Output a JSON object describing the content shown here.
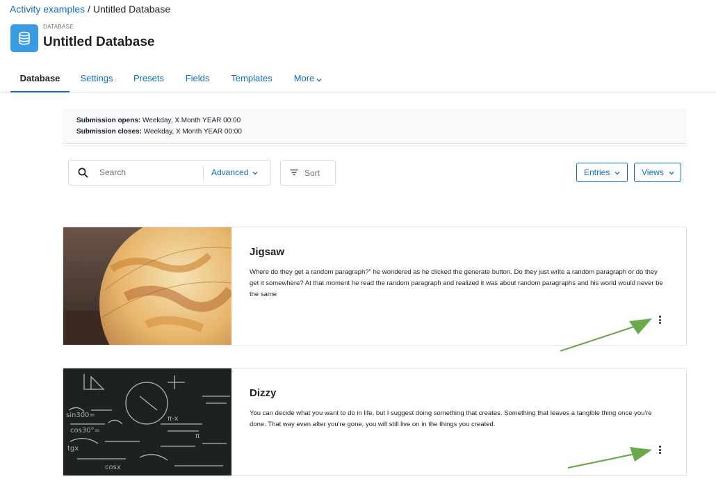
{
  "breadcrumb": {
    "parent": "Activity examples",
    "separator": " / ",
    "current": "Untitled Database"
  },
  "header": {
    "kicker": "DATABASE",
    "title": "Untitled Database",
    "icon": "database-icon",
    "icon_color": "#399be2"
  },
  "tabs": [
    {
      "label": "Database",
      "active": true
    },
    {
      "label": "Settings"
    },
    {
      "label": "Presets"
    },
    {
      "label": "Fields"
    },
    {
      "label": "Templates"
    },
    {
      "label": "More"
    }
  ],
  "info": {
    "opens_label": "Submission opens:",
    "opens_value": " Weekday, X Month YEAR 00:00",
    "closes_label": "Submission closes:",
    "closes_value": " Weekday, X Month YEAR 00:00"
  },
  "toolbar": {
    "search_placeholder": "Search",
    "advanced_label": "Advanced",
    "sort_label": "Sort",
    "entries_label": "Entries",
    "views_label": "Views"
  },
  "entries": [
    {
      "title": "Jigsaw",
      "text": "Where do they get a random paragraph?\" he wondered as he clicked the generate button. Do they just write a random paragraph or do they get it somewhere? At that moment he read the random paragraph and realized it was about random paragraphs and his world would never be the same",
      "image": "globe-photo"
    },
    {
      "title": "Dizzy",
      "text": "You can decide what you want to do in life, but I suggest doing something that creates. Something that leaves a tangible thing once you're done. That way even after you're gone, you will still live on in the things you created.",
      "image": "chalkboard-photo"
    }
  ],
  "colors": {
    "link": "#0f6cbf",
    "annotation_arrow": "#6aaa4a"
  }
}
